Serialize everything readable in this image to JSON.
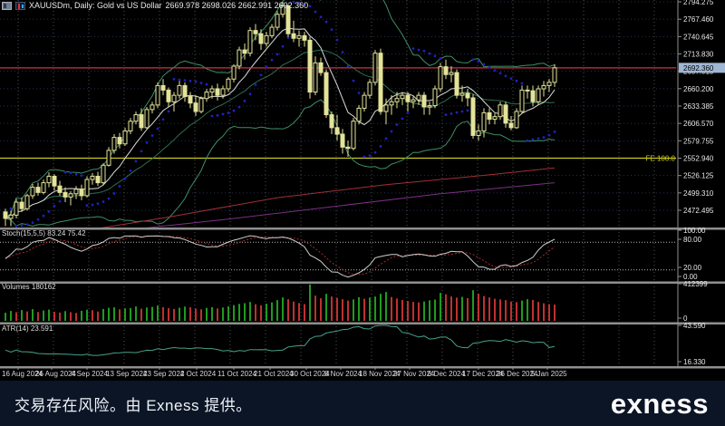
{
  "titlebar": {
    "symbol_line": "XAUUSDm, Daily: Gold vs US Dollar",
    "ohlc_line": "2669.978 2698.026 2662.991 2692.360",
    "icons": [
      "window-icon",
      "chart-icon"
    ]
  },
  "footer": {
    "disclaimer": "交易存在风险。由 Exness 提供。",
    "brand": "exness"
  },
  "panels": {
    "stoch_label": "Stoch(15,5,5) 83.24 75.42",
    "volumes_label": "Volumes 180162",
    "atr_label": "ATR(14) 23.591"
  },
  "chart_data": {
    "type": "candlestick",
    "symbol": "XAUUSDm",
    "timeframe": "Daily",
    "title": "Gold vs US Dollar",
    "price_axis": {
      "ticks": [
        "2794.275",
        "2767.460",
        "2740.645",
        "2713.830",
        "2687.015",
        "2660.200",
        "2633.385",
        "2606.570",
        "2579.755",
        "2552.940",
        "2526.125",
        "2499.310",
        "2472.495"
      ],
      "top_value": 2794.275,
      "bottom_value": 2472.495,
      "current_price": "2692.360",
      "current_price_value": 2692.36
    },
    "levels": {
      "price_line": {
        "value": 2692.36,
        "color": "#d03045"
      },
      "fibo_expansion": {
        "label": "FE 100.0",
        "value": 2552.94,
        "color": "#c9c920"
      }
    },
    "dates": [
      "16 Aug 2024",
      "26 Aug 2024",
      "4 Sep 2024",
      "13 Sep 2024",
      "23 Sep 2024",
      "2 Oct 2024",
      "11 Oct 2024",
      "21 Oct 2024",
      "30 Oct 2024",
      "8 Nov 2024",
      "18 Nov 2024",
      "27 Nov 2024",
      "6 Dec 2024",
      "17 Dec 2024",
      "26 Dec 2024",
      "5 Jan 2025"
    ],
    "date_x": [
      2,
      39,
      78,
      117,
      158,
      199,
      240,
      280,
      320,
      358,
      396,
      434,
      472,
      510,
      548,
      586
    ],
    "stoch_axis": {
      "ticks": [
        "100.00",
        "80.00",
        "20.00",
        "0.00"
      ],
      "levels": [
        80,
        20
      ],
      "current": [
        83.24,
        75.42
      ]
    },
    "volume_axis": {
      "max_label": "412399",
      "min_label": "0",
      "max_value": 412399,
      "current": 180162
    },
    "atr_axis": {
      "max_label": "43.590",
      "min_label": "16.330",
      "max_value": 43.59,
      "min_value": 16.33,
      "current": 23.591
    },
    "indicators": [
      {
        "name": "Bollinger Bands",
        "color": "#3d8f66"
      },
      {
        "name": "MA fast",
        "color": "#dcdcdc"
      },
      {
        "name": "MA slow red",
        "color": "#a03038"
      },
      {
        "name": "MA slow purple",
        "color": "#7c2f86"
      },
      {
        "name": "Parabolic SAR",
        "color": "#2020c0"
      },
      {
        "name": "Stochastic(15,5,5)",
        "colors": [
          "#cfcfcf",
          "#a52a2a"
        ]
      },
      {
        "name": "Volumes",
        "colors": [
          "#1f9b1f",
          "#c03030"
        ]
      },
      {
        "name": "ATR(14)",
        "color": "#48a08a"
      }
    ],
    "overlay_lines": {
      "red_ma": [
        [
          10,
          2435
        ],
        [
          30,
          2462
        ],
        [
          50,
          2492
        ],
        [
          70,
          2512
        ],
        [
          90,
          2528
        ],
        [
          101,
          2538
        ]
      ],
      "purple_ma": [
        [
          20,
          2440
        ],
        [
          40,
          2458
        ],
        [
          60,
          2478
        ],
        [
          80,
          2498
        ],
        [
          101,
          2515
        ]
      ]
    },
    "candles": [
      [
        2470,
        2475,
        2448,
        2460
      ],
      [
        2460,
        2472,
        2448,
        2465
      ],
      [
        2465,
        2490,
        2460,
        2485
      ],
      [
        2485,
        2492,
        2470,
        2475
      ],
      [
        2475,
        2498,
        2472,
        2495
      ],
      [
        2495,
        2513,
        2490,
        2508
      ],
      [
        2508,
        2515,
        2495,
        2500
      ],
      [
        2500,
        2520,
        2497,
        2515
      ],
      [
        2515,
        2531,
        2508,
        2525
      ],
      [
        2525,
        2528,
        2503,
        2510
      ],
      [
        2510,
        2518,
        2495,
        2500
      ],
      [
        2500,
        2508,
        2485,
        2493
      ],
      [
        2493,
        2502,
        2480,
        2498
      ],
      [
        2498,
        2510,
        2490,
        2505
      ],
      [
        2505,
        2512,
        2488,
        2495
      ],
      [
        2495,
        2525,
        2492,
        2520
      ],
      [
        2520,
        2530,
        2512,
        2525
      ],
      [
        2525,
        2532,
        2510,
        2515
      ],
      [
        2515,
        2545,
        2512,
        2542
      ],
      [
        2542,
        2570,
        2540,
        2565
      ],
      [
        2565,
        2590,
        2560,
        2585
      ],
      [
        2585,
        2592,
        2568,
        2575
      ],
      [
        2575,
        2600,
        2572,
        2595
      ],
      [
        2595,
        2615,
        2590,
        2610
      ],
      [
        2610,
        2625,
        2605,
        2620
      ],
      [
        2620,
        2630,
        2595,
        2600
      ],
      [
        2600,
        2632,
        2598,
        2628
      ],
      [
        2628,
        2640,
        2622,
        2635
      ],
      [
        2635,
        2670,
        2630,
        2665
      ],
      [
        2665,
        2675,
        2650,
        2658
      ],
      [
        2658,
        2662,
        2632,
        2640
      ],
      [
        2640,
        2655,
        2625,
        2650
      ],
      [
        2650,
        2672,
        2645,
        2665
      ],
      [
        2665,
        2670,
        2640,
        2648
      ],
      [
        2648,
        2655,
        2630,
        2638
      ],
      [
        2638,
        2650,
        2618,
        2625
      ],
      [
        2625,
        2648,
        2622,
        2645
      ],
      [
        2645,
        2660,
        2640,
        2655
      ],
      [
        2655,
        2665,
        2645,
        2660
      ],
      [
        2660,
        2668,
        2642,
        2650
      ],
      [
        2650,
        2665,
        2645,
        2660
      ],
      [
        2660,
        2678,
        2655,
        2675
      ],
      [
        2675,
        2698,
        2670,
        2695
      ],
      [
        2695,
        2725,
        2690,
        2720
      ],
      [
        2720,
        2730,
        2705,
        2715
      ],
      [
        2715,
        2755,
        2710,
        2750
      ],
      [
        2750,
        2760,
        2735,
        2745
      ],
      [
        2745,
        2752,
        2720,
        2730
      ],
      [
        2730,
        2748,
        2725,
        2742
      ],
      [
        2742,
        2760,
        2738,
        2755
      ],
      [
        2755,
        2780,
        2750,
        2775
      ],
      [
        2775,
        2794,
        2770,
        2788
      ],
      [
        2788,
        2790,
        2740,
        2745
      ],
      [
        2745,
        2765,
        2732,
        2738
      ],
      [
        2738,
        2750,
        2725,
        2742
      ],
      [
        2742,
        2748,
        2725,
        2735
      ],
      [
        2735,
        2740,
        2645,
        2655
      ],
      [
        2655,
        2710,
        2650,
        2700
      ],
      [
        2700,
        2708,
        2680,
        2685
      ],
      [
        2685,
        2690,
        2615,
        2620
      ],
      [
        2620,
        2625,
        2590,
        2600
      ],
      [
        2600,
        2620,
        2580,
        2590
      ],
      [
        2590,
        2598,
        2560,
        2570
      ],
      [
        2570,
        2580,
        2555,
        2568
      ],
      [
        2568,
        2615,
        2565,
        2610
      ],
      [
        2610,
        2635,
        2605,
        2630
      ],
      [
        2630,
        2655,
        2625,
        2650
      ],
      [
        2650,
        2675,
        2645,
        2670
      ],
      [
        2670,
        2720,
        2665,
        2715
      ],
      [
        2715,
        2722,
        2620,
        2625
      ],
      [
        2625,
        2645,
        2605,
        2635
      ],
      [
        2635,
        2650,
        2620,
        2640
      ],
      [
        2640,
        2655,
        2630,
        2645
      ],
      [
        2645,
        2655,
        2635,
        2650
      ],
      [
        2650,
        2655,
        2625,
        2640
      ],
      [
        2640,
        2648,
        2630,
        2643
      ],
      [
        2643,
        2655,
        2635,
        2650
      ],
      [
        2650,
        2655,
        2620,
        2632
      ],
      [
        2632,
        2640,
        2620,
        2634
      ],
      [
        2634,
        2665,
        2630,
        2660
      ],
      [
        2660,
        2700,
        2655,
        2694
      ],
      [
        2694,
        2705,
        2675,
        2682
      ],
      [
        2682,
        2695,
        2670,
        2685
      ],
      [
        2685,
        2690,
        2645,
        2650
      ],
      [
        2650,
        2665,
        2640,
        2653
      ],
      [
        2653,
        2660,
        2633,
        2646
      ],
      [
        2646,
        2652,
        2583,
        2588
      ],
      [
        2588,
        2605,
        2580,
        2595
      ],
      [
        2595,
        2630,
        2585,
        2623
      ],
      [
        2623,
        2630,
        2605,
        2613
      ],
      [
        2613,
        2622,
        2605,
        2617
      ],
      [
        2617,
        2640,
        2612,
        2635
      ],
      [
        2635,
        2640,
        2600,
        2607
      ],
      [
        2607,
        2618,
        2596,
        2600
      ],
      [
        2600,
        2630,
        2598,
        2625
      ],
      [
        2625,
        2665,
        2622,
        2658
      ],
      [
        2658,
        2665,
        2645,
        2657
      ],
      [
        2657,
        2665,
        2633,
        2640
      ],
      [
        2640,
        2665,
        2635,
        2660
      ],
      [
        2660,
        2672,
        2648,
        2665
      ],
      [
        2665,
        2675,
        2655,
        2670
      ],
      [
        2669.978,
        2698.026,
        2662.991,
        2692.36
      ]
    ],
    "volumes": [
      90000,
      110000,
      95000,
      120000,
      105000,
      130000,
      98000,
      115000,
      125000,
      100000,
      92000,
      108000,
      96000,
      88000,
      112000,
      124000,
      118000,
      104000,
      132000,
      145000,
      150000,
      128000,
      138000,
      142000,
      160000,
      135000,
      148000,
      155000,
      170000,
      152000,
      140000,
      132000,
      146000,
      158000,
      150000,
      136000,
      128000,
      144000,
      152000,
      138000,
      148000,
      162000,
      175000,
      188000,
      196000,
      210000,
      185000,
      172000,
      190000,
      205000,
      230000,
      260000,
      240000,
      215000,
      198000,
      186000,
      405000,
      280000,
      250000,
      300000,
      270000,
      255000,
      240000,
      225000,
      238000,
      262000,
      245000,
      258000,
      270000,
      300000,
      320000,
      265000,
      248000,
      232000,
      220000,
      210000,
      205000,
      215000,
      228000,
      236000,
      310000,
      295000,
      270000,
      258000,
      266000,
      252000,
      340000,
      300000,
      275000,
      260000,
      245000,
      238000,
      230000,
      215000,
      208000,
      225000,
      240000,
      232000,
      210000,
      195000,
      185000,
      180162
    ]
  }
}
